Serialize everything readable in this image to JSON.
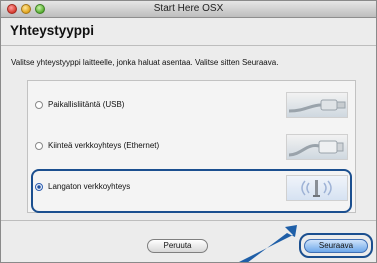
{
  "window": {
    "title": "Start Here OSX"
  },
  "page": {
    "heading": "Yhteystyyppi",
    "instruction": "Valitse yhteystyyppi laitteelle, jonka haluat asentaa. Valitse sitten Seuraava."
  },
  "options": [
    {
      "label": "Paikallisliitäntä (USB)",
      "selected": false,
      "icon": "usb-cable-icon"
    },
    {
      "label": "Kiinteä verkkoyhteys (Ethernet)",
      "selected": false,
      "icon": "ethernet-cable-icon"
    },
    {
      "label": "Langaton verkkoyhteys",
      "selected": true,
      "icon": "wireless-signal-icon"
    }
  ],
  "buttons": {
    "cancel": "Peruuta",
    "next": "Seuraava"
  },
  "colors": {
    "highlight": "#1b4f8f",
    "arrow": "#1f5fa8"
  }
}
